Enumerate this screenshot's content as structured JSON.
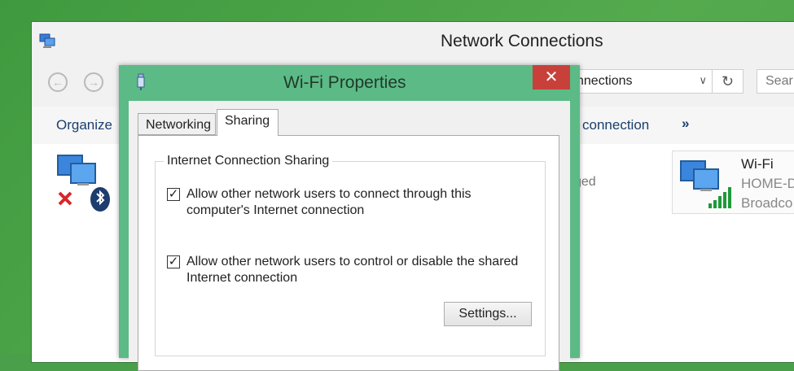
{
  "explorer": {
    "title": "Network Connections",
    "address_text": "nnections",
    "search_placeholder": "Sear",
    "commands": {
      "organize": "Organize",
      "connection": "connection",
      "more": "»"
    },
    "status_partial": "ged",
    "wifi_tile": {
      "name": "Wi-Fi",
      "network": "HOME-D",
      "adapter": "Broadco"
    }
  },
  "dialog": {
    "title": "Wi-Fi Properties",
    "close_glyph": "✕",
    "tabs": [
      {
        "label": "Networking",
        "selected": false
      },
      {
        "label": "Sharing",
        "selected": true
      }
    ],
    "group_title": "Internet Connection Sharing",
    "options": [
      {
        "label": "Allow other network users to connect through this computer's Internet connection",
        "checked": true
      },
      {
        "label": "Allow other network users to control or disable the shared Internet connection",
        "checked": true
      }
    ],
    "settings_button": "Settings..."
  },
  "icons": {
    "back": "back-arrow-icon",
    "forward": "forward-arrow-icon",
    "refresh": "refresh-icon",
    "dropdown": "chevron-down-icon"
  },
  "colors": {
    "dialog_frame": "#5cba86",
    "close_button": "#c7413a",
    "desktop": "#4aa04a"
  }
}
